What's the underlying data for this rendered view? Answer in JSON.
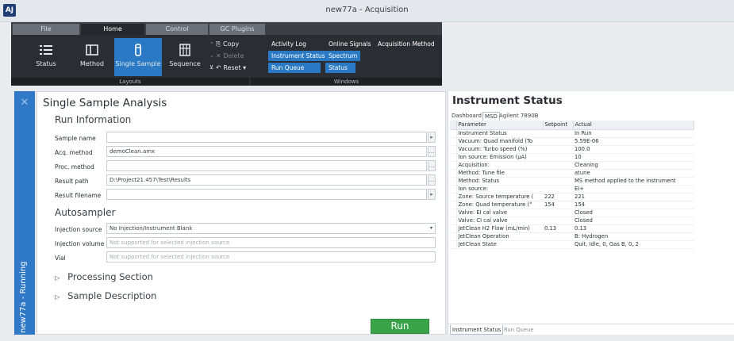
{
  "window": {
    "title": "new77a - Acquisition",
    "app_badge": "AJ"
  },
  "ribbon": {
    "tabs": [
      "File",
      "Home",
      "Control",
      "GC Plugins"
    ],
    "layout_buttons": [
      "Status",
      "Method",
      "Single Sample",
      "Sequence"
    ],
    "edit": {
      "copy": "Copy",
      "delete": "Delete",
      "reset": "Reset"
    },
    "windows": {
      "row1": [
        "Activity Log",
        "Online Signals",
        "Acquisition Method"
      ],
      "row2": [
        "Instrument Status",
        "Spectrum"
      ],
      "row3": [
        "Run Queue",
        "Status"
      ]
    },
    "group_layouts": "Layouts",
    "group_windows": "Windows"
  },
  "sidebar": {
    "label": "new77a - Running"
  },
  "single_sample": {
    "title": "Single Sample Analysis",
    "run_info": {
      "heading": "Run Information",
      "sample_name_label": "Sample name",
      "sample_name_value": "",
      "acq_method_label": "Acq. method",
      "acq_method_value": "demoClean.amx",
      "proc_method_label": "Proc. method",
      "proc_method_value": "",
      "result_path_label": "Result path",
      "result_path_value": "D:\\Project21.457\\Test\\Results",
      "result_filename_label": "Result filename",
      "result_filename_value": ""
    },
    "autosampler": {
      "heading": "Autosampler",
      "injection_source_label": "Injection source",
      "injection_source_value": "No Injection/Instrument Blank",
      "injection_volume_label": "Injection volume",
      "injection_volume_placeholder": "Not supported for selected injection source",
      "vial_label": "Vial",
      "vial_placeholder": "Not supported for selected injection source"
    },
    "processing_section": "Processing Section",
    "sample_description": "Sample Description",
    "run_button": "Run"
  },
  "instrument_status": {
    "title": "Instrument Status",
    "tabs": [
      "Dashboard",
      "MSD",
      "Agilent 7890B"
    ],
    "columns": [
      "Parameter",
      "Setpoint",
      "Actual"
    ],
    "rows": [
      [
        "Instrument Status",
        "",
        "In Run"
      ],
      [
        "Vacuum: Quad manifold (To",
        "",
        "5.59E-06"
      ],
      [
        "Vacuum: Turbo speed (%)",
        "",
        "100.0"
      ],
      [
        "Ion source: Emission (µA)",
        "",
        "10"
      ],
      [
        "Acquisition:",
        "",
        "Cleaning"
      ],
      [
        "Method: Tune file",
        "",
        "atune"
      ],
      [
        "Method: Status",
        "",
        "MS method applied to the instrument"
      ],
      [
        "Ion source:",
        "",
        "EI+"
      ],
      [
        "Zone: Source temperature (",
        "222",
        "221"
      ],
      [
        "Zone: Quad temperature (°",
        "154",
        "154"
      ],
      [
        "Valve: EI cal valve",
        "",
        "Closed"
      ],
      [
        "Valve: CI cal valve",
        "",
        "Closed"
      ],
      [
        "JetClean H2 Flow (mL/min)",
        "0.13",
        "0.13"
      ],
      [
        "JetClean Operation",
        "",
        "B: Hydrogen"
      ],
      [
        "JetClean State",
        "",
        "Quit, Idle, 0, Gas B, 0, 2"
      ]
    ],
    "bottom_tabs": [
      "Instrument Status",
      "Run Queue"
    ]
  },
  "colors": {
    "accent": "#2a79c4",
    "run": "#3aa34a",
    "ribbon": "#2a2d31"
  }
}
